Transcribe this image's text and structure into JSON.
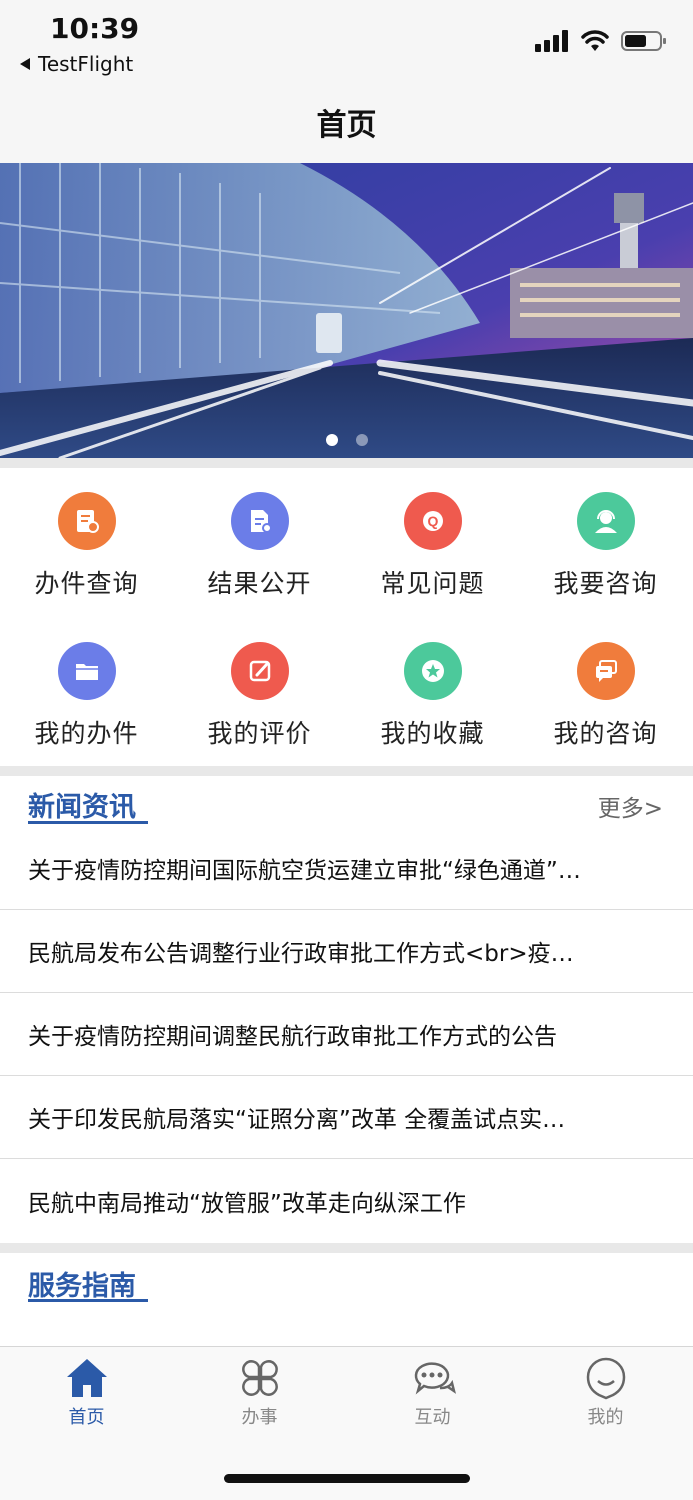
{
  "status_bar": {
    "time": "10:39",
    "back_app": "TestFlight",
    "icons": [
      "signal-icon",
      "wifi-icon",
      "battery-icon"
    ]
  },
  "nav": {
    "title": "首页"
  },
  "banner": {
    "pages": 2,
    "active_index": 0
  },
  "grid": {
    "items": [
      {
        "label": "办件查询",
        "icon": "document-search-icon",
        "color": "#f07c3c"
      },
      {
        "label": "结果公开",
        "icon": "document-edit-icon",
        "color": "#6b7de8"
      },
      {
        "label": "常见问题",
        "icon": "question-icon",
        "color": "#ef5a4e"
      },
      {
        "label": "我要咨询",
        "icon": "customer-service-icon",
        "color": "#4cc99b"
      },
      {
        "label": "我的办件",
        "icon": "folder-icon",
        "color": "#6b7de8"
      },
      {
        "label": "我的评价",
        "icon": "pencil-icon",
        "color": "#ef5a4e"
      },
      {
        "label": "我的收藏",
        "icon": "star-icon",
        "color": "#4cc99b"
      },
      {
        "label": "我的咨询",
        "icon": "chat-icon",
        "color": "#f07c3c"
      }
    ]
  },
  "news": {
    "title": "新闻资讯",
    "more": "更多>",
    "items": [
      "关于疫情防控期间国际航空货运建立审批“绿色通道”…",
      "民航局发布公告调整行业行政审批工作方式<br>疫…",
      "关于疫情防控期间调整民航行政审批工作方式的公告",
      "关于印发民航局落实“证照分离”改革 全覆盖试点实…",
      "民航中南局推动“放管服”改革走向纵深工作"
    ]
  },
  "guide": {
    "title": "服务指南"
  },
  "tab_bar": {
    "active": 0,
    "items": [
      {
        "label": "首页",
        "icon": "home-icon"
      },
      {
        "label": "办事",
        "icon": "grid-petals-icon"
      },
      {
        "label": "互动",
        "icon": "chat-bubbles-icon"
      },
      {
        "label": "我的",
        "icon": "user-face-icon"
      }
    ]
  },
  "colors": {
    "accent": "#2b5aa8",
    "separator": "#e8e8e8"
  }
}
